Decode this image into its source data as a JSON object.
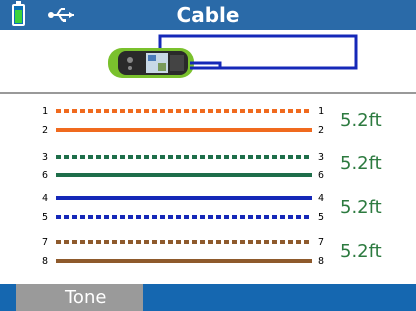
{
  "header": {
    "title": "Cable",
    "battery_icon": "battery-icon",
    "usb_icon": "usb-icon"
  },
  "wire_map": {
    "pairs": [
      {
        "pins": [
          "1",
          "2"
        ],
        "length": "5.2ft"
      },
      {
        "pins": [
          "3",
          "6"
        ],
        "length": "5.2ft"
      },
      {
        "pins": [
          "4",
          "5"
        ],
        "length": "5.2ft"
      },
      {
        "pins": [
          "7",
          "8"
        ],
        "length": "5.2ft"
      }
    ],
    "wires": [
      {
        "pin": "1",
        "color": "#f06a1e",
        "style": "striped"
      },
      {
        "pin": "2",
        "color": "#f06a1e",
        "style": "solid"
      },
      {
        "pin": "3",
        "color": "#1e6e4a",
        "style": "striped"
      },
      {
        "pin": "6",
        "color": "#1e6e4a",
        "style": "solid"
      },
      {
        "pin": "4",
        "color": "#1528b8",
        "style": "solid"
      },
      {
        "pin": "5",
        "color": "#1528b8",
        "style": "striped"
      },
      {
        "pin": "7",
        "color": "#8e5a2c",
        "style": "striped"
      },
      {
        "pin": "8",
        "color": "#8e5a2c",
        "style": "solid"
      }
    ]
  },
  "softkeys": {
    "f1_label": "Tone"
  },
  "colors": {
    "title_bar": "#2a6aa8",
    "bottom_bar": "#1567b0",
    "softkey_bg": "#9a9a9a",
    "length_text": "#2c7a3f",
    "cable_blue": "#1528b8"
  }
}
